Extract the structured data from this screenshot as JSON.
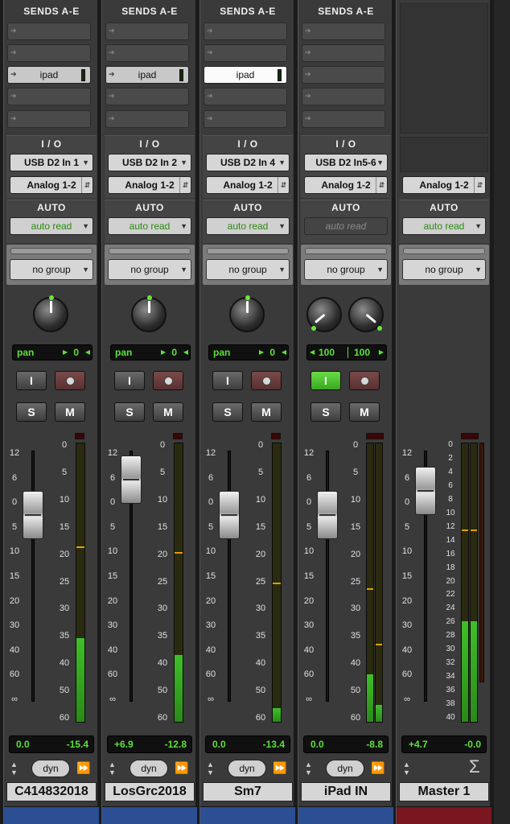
{
  "colors": {
    "accent_green": "#5be13a",
    "strip_blue": "#2c4f93",
    "master_red": "#7a1620"
  },
  "labels": {
    "sends": "SENDS A-E",
    "io": "I / O",
    "auto": "AUTO"
  },
  "fader_scale": [
    "12",
    "6",
    "0",
    "5",
    "10",
    "15",
    "20",
    "30",
    "40",
    "60",
    "∞"
  ],
  "meter_scale": [
    "0",
    "5",
    "10",
    "15",
    "20",
    "25",
    "30",
    "35",
    "40",
    "50",
    "60"
  ],
  "master_meter_scale": [
    "0",
    "2",
    "4",
    "6",
    "8",
    "10",
    "12",
    "14",
    "16",
    "18",
    "20",
    "22",
    "24",
    "26",
    "28",
    "30",
    "32",
    "34",
    "36",
    "38",
    "40"
  ],
  "channels": [
    {
      "send_label": "ipad",
      "input": "USB D2 In 1",
      "output": "Analog 1-2",
      "auto": "auto read",
      "group": "no group",
      "pan_label": "pan",
      "pan_value": "0",
      "input_btn": "I",
      "solo": "S",
      "mute": "M",
      "volume": "0.0",
      "peak": "-15.4",
      "dyn": "dyn",
      "name": "C414832018",
      "meter_level": 0.3,
      "peak_hold": 0.63
    },
    {
      "send_label": "ipad",
      "input": "USB D2 In 2",
      "output": "Analog 1-2",
      "auto": "auto read",
      "group": "no group",
      "pan_label": "pan",
      "pan_value": "0",
      "input_btn": "I",
      "solo": "S",
      "mute": "M",
      "volume": "+6.9",
      "peak": "-12.8",
      "dyn": "dyn",
      "name": "LosGrc2018",
      "meter_level": 0.24,
      "peak_hold": 0.61
    },
    {
      "send_label": "ipad",
      "input": "USB D2 In 4",
      "output": "Analog 1-2",
      "auto": "auto read",
      "group": "no group",
      "pan_label": "pan",
      "pan_value": "0",
      "input_btn": "I",
      "solo": "S",
      "mute": "M",
      "volume": "0.0",
      "peak": "-13.4",
      "dyn": "dyn",
      "name": "Sm7",
      "meter_level": 0.05,
      "peak_hold": 0.5
    },
    {
      "send_label": "",
      "input": "USB D2 In5-6",
      "output": "Analog 1-2",
      "auto": "auto read",
      "group": "no group",
      "pan_left": "100",
      "pan_right": "100",
      "input_btn": "I",
      "solo": "S",
      "mute": "M",
      "volume": "0.0",
      "peak": "-8.8",
      "dyn": "dyn",
      "name": "iPad IN",
      "meter_level": 0.17,
      "meter_level_r": 0.06,
      "peak_hold": 0.48,
      "peak_hold_r": 0.28
    },
    {
      "output": "Analog 1-2",
      "auto": "auto read",
      "group": "no group",
      "volume": "+4.7",
      "peak": "-0.0",
      "name": "Master 1",
      "meter_level": 0.36,
      "meter_level_r": 0.36,
      "peak_hold": 0.69,
      "peak_hold_r": 0.69
    }
  ]
}
